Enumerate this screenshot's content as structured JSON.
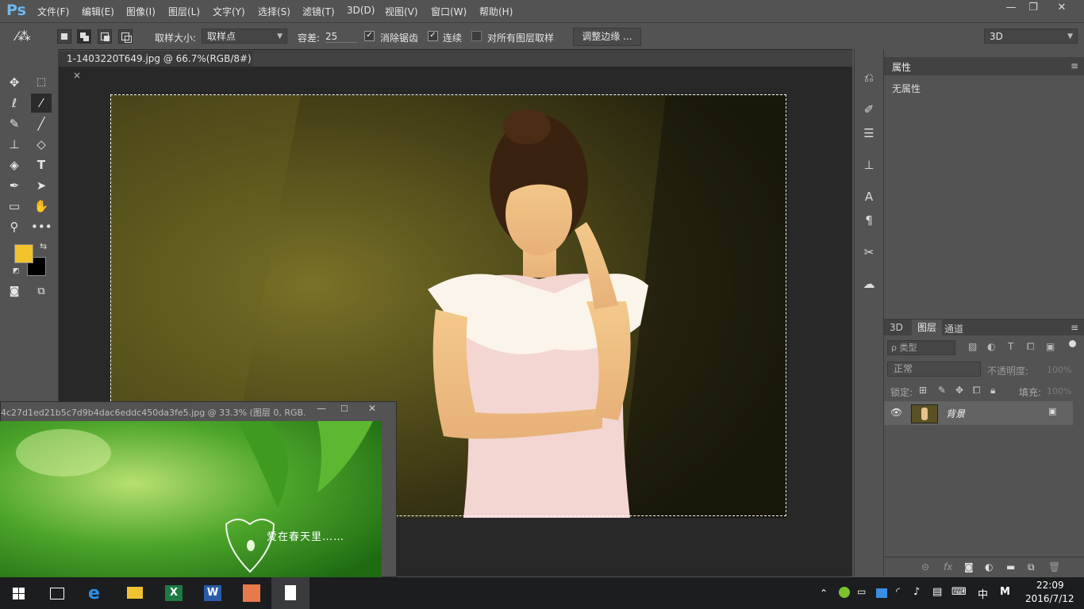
{
  "app": {
    "logo": "Ps"
  },
  "menu": [
    "文件(F)",
    "编辑(E)",
    "图像(I)",
    "图层(L)",
    "文字(Y)",
    "选择(S)",
    "滤镜(T)",
    "3D(D)",
    "视图(V)",
    "窗口(W)",
    "帮助(H)"
  ],
  "window_controls": {
    "minimize": "—",
    "restore": "❐",
    "close": "✕"
  },
  "options": {
    "sample_size_label": "取样大小:",
    "sample_size_value": "取样点",
    "tolerance_label": "容差:",
    "tolerance_value": "25",
    "antialias_label": "消除锯齿",
    "contiguous_label": "连续",
    "all_layers_label": "对所有图层取样",
    "refine_edge_label": "调整边缘 ...",
    "workspace_value": "3D"
  },
  "document": {
    "tab_title": "1-1403220T649.jpg @ 66.7%(RGB/8#)",
    "close": "×"
  },
  "second_window": {
    "title": "4c27d1ed21b5c7d9b4dac6eddc450da3fe5.jpg @ 33.3% (图层 0, RGB...",
    "caption": "爱在春天里……"
  },
  "properties": {
    "tab": "属性",
    "content": "无属性"
  },
  "layers_panel": {
    "tabs": [
      "3D",
      "图层",
      "通道"
    ],
    "filter_label": "ρ 类型",
    "blend_mode": "正常",
    "opacity_label": "不透明度:",
    "opacity_value": "100%",
    "lock_label": "锁定:",
    "fill_label": "填充:",
    "fill_value": "100%",
    "layers": [
      {
        "name": "背景",
        "visible": true,
        "locked": true
      }
    ],
    "bottom_icons": [
      "link-icon",
      "fx-icon",
      "mask-icon",
      "adjustment-icon",
      "folder-icon",
      "new-layer-icon",
      "trash-icon"
    ],
    "fx_text": "fx"
  },
  "colors": {
    "foreground": "#f2c42c",
    "background": "#000000",
    "accent": "#6fb7ef"
  },
  "taskbar": {
    "apps": [
      "windows-start",
      "task-view",
      "edge",
      "file-explorer",
      "excel",
      "word",
      "photoshop-app",
      "notepad"
    ],
    "time": "22:09",
    "date": "2016/7/12",
    "ime": "中",
    "ime2": "M"
  }
}
